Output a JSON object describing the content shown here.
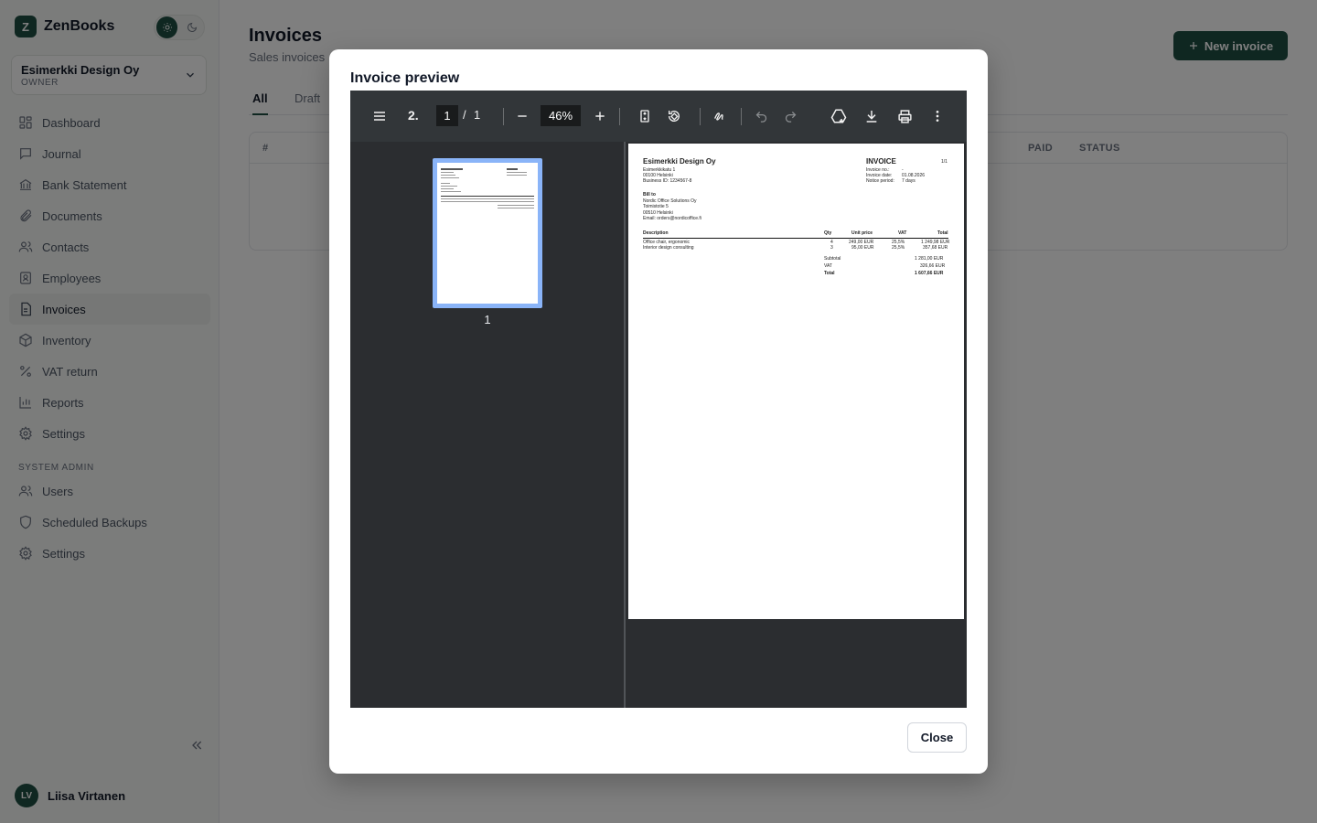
{
  "app": {
    "name": "ZenBooks",
    "logo_letter": "Z"
  },
  "org": {
    "name": "Esimerkki Design Oy",
    "role": "OWNER"
  },
  "nav": {
    "items": [
      {
        "label": "Dashboard",
        "icon": "dashboard-icon"
      },
      {
        "label": "Journal",
        "icon": "journal-icon"
      },
      {
        "label": "Bank Statement",
        "icon": "bank-icon"
      },
      {
        "label": "Documents",
        "icon": "paperclip-icon"
      },
      {
        "label": "Contacts",
        "icon": "contacts-icon"
      },
      {
        "label": "Employees",
        "icon": "employee-icon"
      },
      {
        "label": "Invoices",
        "icon": "invoice-icon",
        "active": true
      },
      {
        "label": "Inventory",
        "icon": "box-icon"
      },
      {
        "label": "VAT return",
        "icon": "percent-icon"
      },
      {
        "label": "Reports",
        "icon": "chart-icon"
      },
      {
        "label": "Settings",
        "icon": "gear-icon"
      }
    ],
    "admin_section_label": "SYSTEM ADMIN",
    "admin_items": [
      {
        "label": "Users",
        "icon": "users-icon"
      },
      {
        "label": "Scheduled Backups",
        "icon": "shield-icon"
      },
      {
        "label": "Settings",
        "icon": "gear-icon"
      }
    ]
  },
  "user": {
    "initials": "LV",
    "name": "Liisa Virtanen"
  },
  "page": {
    "title": "Invoices",
    "subtitle": "Sales invoices",
    "new_button": "New invoice",
    "tabs": [
      "All",
      "Draft"
    ],
    "table_headers": [
      "#",
      "PAID",
      "STATUS"
    ]
  },
  "modal": {
    "title": "Invoice preview",
    "close_label": "Close",
    "viewer": {
      "page_current": "1",
      "page_separator": "/",
      "page_total": "1",
      "zoom": "46%",
      "thumbnail_label": "1",
      "sidebar_toggle_label": "2."
    },
    "invoice": {
      "seller_name": "Esimerkki Design Oy",
      "seller_address_1": "Esimerkkikatu 1",
      "seller_address_2": "00100 Helsinki",
      "seller_business_id": "Business ID: 1234567-8",
      "doc_title": "INVOICE",
      "page_marker": "1/1",
      "meta": [
        {
          "label": "Invoice no.:",
          "value": "-"
        },
        {
          "label": "Invoice date:",
          "value": "01.08.2026"
        },
        {
          "label": "Notice period:",
          "value": "7 days"
        }
      ],
      "bill_to_label": "Bill to",
      "bill_to": [
        "Nordic Office Solutions Oy",
        "Toimistotie 5",
        "00510 Helsinki",
        "Email: orders@nordicoffice.fi"
      ],
      "columns": [
        "Description",
        "Qty",
        "Unit price",
        "VAT",
        "Total"
      ],
      "lines": [
        {
          "description": "Office chair, ergonomic",
          "qty": "4",
          "unit_price": "249,00 EUR",
          "vat": "25,5%",
          "total": "1 249,98 EUR"
        },
        {
          "description": "Interior design consulting",
          "qty": "3",
          "unit_price": "95,00 EUR",
          "vat": "25,5%",
          "total": "357,68 EUR"
        }
      ],
      "subtotal_label": "Subtotal",
      "subtotal": "1 281,00 EUR",
      "vat_label": "VAT",
      "vat": "326,66 EUR",
      "total_label": "Total",
      "total": "1 607,66 EUR"
    }
  },
  "colors": {
    "brand": "#1f4e43",
    "pdf_toolbar": "#323639",
    "pdf_background": "#2b2d30",
    "thumbnail_highlight": "#8ab4f8"
  }
}
